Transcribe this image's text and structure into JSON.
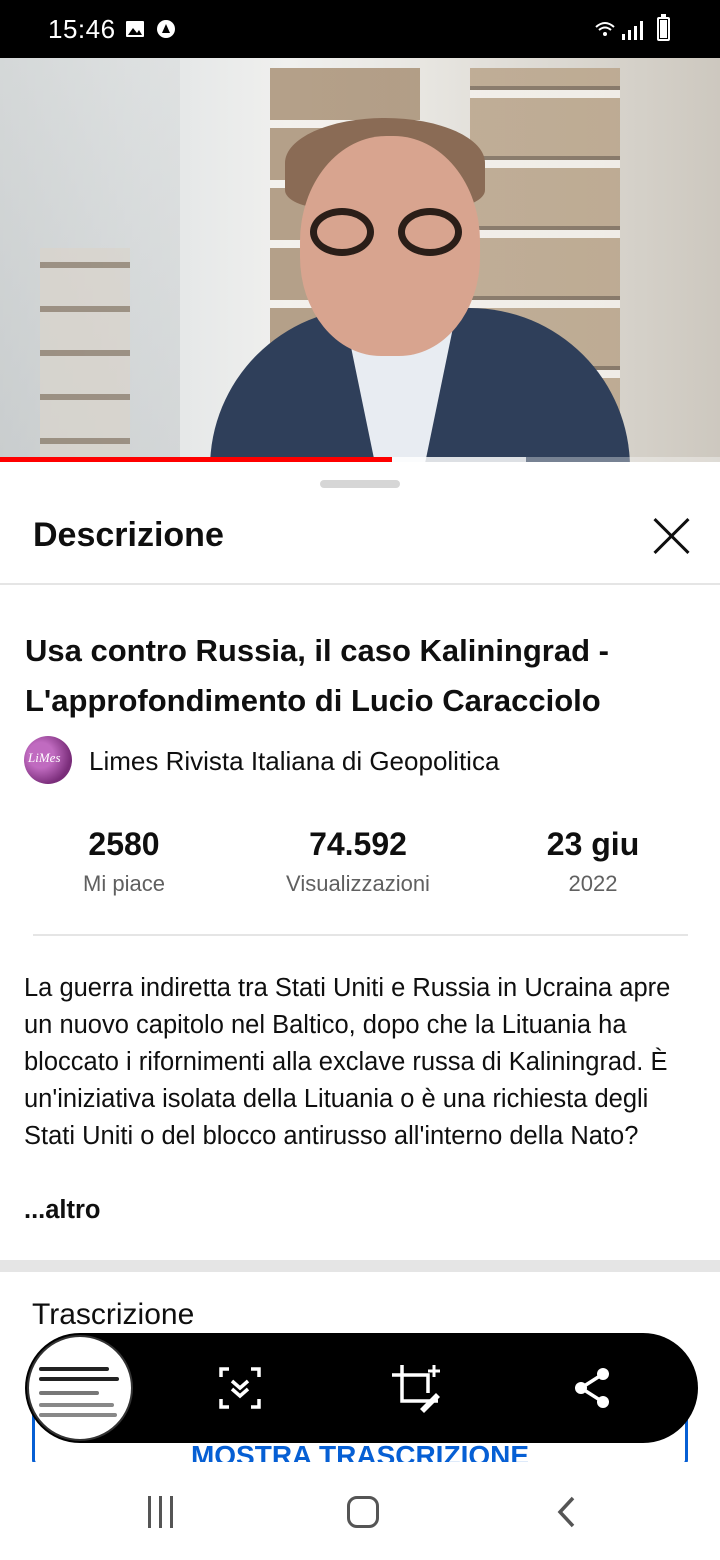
{
  "status_bar": {
    "time": "15:46"
  },
  "video": {
    "progress_fraction": 0.545,
    "buffer_fraction": 0.73
  },
  "sheet": {
    "title": "Descrizione",
    "video_title": "Usa contro Russia, il caso Kaliningrad - L'approfondimento di Lucio Caracciolo",
    "channel": "Limes Rivista Italiana di Geopolitica",
    "stats": [
      {
        "value": "2580",
        "label": "Mi piace"
      },
      {
        "value": "74.592",
        "label": "Visualizzazioni"
      },
      {
        "value": "23 giu",
        "label": "2022"
      }
    ],
    "description": "La guerra indiretta tra Stati Uniti e Russia in Ucraina apre un nuovo capitolo nel Baltico, dopo che la Lituania ha bloccato i rifornimenti alla exclave russa di Kaliningrad. È un'iniziativa isolata della Lituania o è una richiesta degli Stati Uniti o del blocco antirusso all'interno della Nato?",
    "more": "...altro",
    "transcript_title": "Trascrizione",
    "transcript_button": "MOSTRA TRASCRIZIONE"
  },
  "colors": {
    "accent_blue": "#065fd4",
    "progress_red": "#ff0000"
  }
}
